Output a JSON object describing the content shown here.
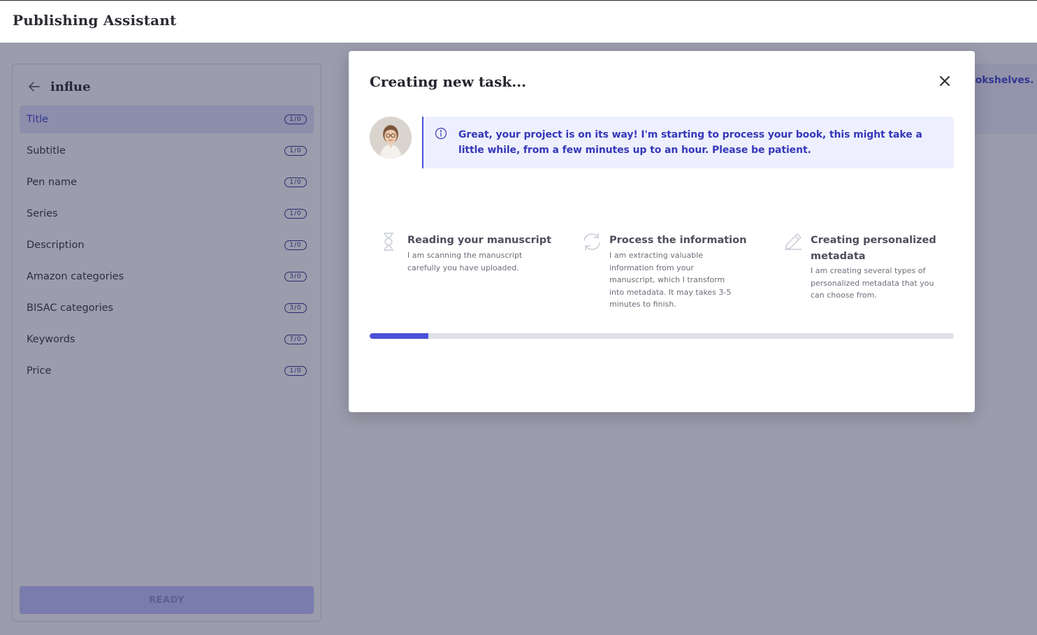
{
  "app": {
    "title": "Publishing Assistant"
  },
  "sidebar": {
    "project_name": "influe",
    "back_icon": "arrow-left-icon",
    "items": [
      {
        "label": "Title",
        "badge": "1/0",
        "active": true
      },
      {
        "label": "Subtitle",
        "badge": "1/0"
      },
      {
        "label": "Pen name",
        "badge": "1/0"
      },
      {
        "label": "Series",
        "badge": "1/0"
      },
      {
        "label": "Description",
        "badge": "1/0"
      },
      {
        "label": "Amazon categories",
        "badge": "3/0"
      },
      {
        "label": "BISAC categories",
        "badge": "3/0"
      },
      {
        "label": "Keywords",
        "badge": "7/0"
      },
      {
        "label": "Price",
        "badge": "1/0"
      }
    ],
    "ready_label": "READY"
  },
  "background_info": {
    "text": "ookshelves. W"
  },
  "modal": {
    "title": "Creating new task...",
    "close_icon": "close-icon",
    "message": "Great, your project is on its way! I'm starting to process your book, this might take a little while, from a few minutes up to an hour. Please be patient.",
    "message_icon": "info-icon",
    "steps": [
      {
        "icon": "hourglass-icon",
        "title": "Reading your manuscript",
        "description": "I am scanning the manuscript carefully you have uploaded."
      },
      {
        "icon": "refresh-icon",
        "title": "Process the information",
        "description": "I am extracting valuable information from your manuscript, which I transform into metadata. It may takes 3-5 minutes to finish."
      },
      {
        "icon": "pencil-icon",
        "title": "Creating personalized metadata",
        "description": "I am creating several types of personalized metadata that you can choose from."
      }
    ],
    "progress_percent": 10
  },
  "colors": {
    "accent": "#4b50d8",
    "accent_text": "#3538b8",
    "message_bg": "#eef0ff",
    "overlay": "rgba(42,45,78,0.47)"
  }
}
